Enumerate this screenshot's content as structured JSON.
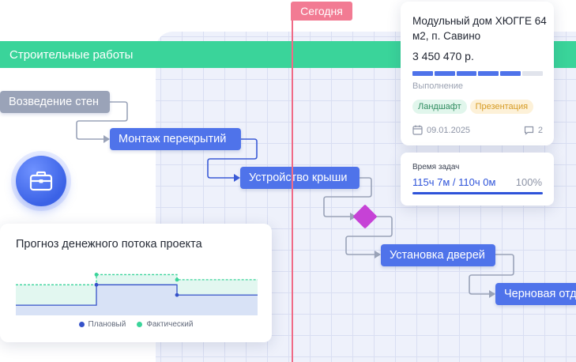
{
  "stage": {
    "label": "Строительные работы"
  },
  "today": {
    "label": "Сегодня"
  },
  "tasks": [
    {
      "label": "Возведение стен"
    },
    {
      "label": "Монтаж перекрытий"
    },
    {
      "label": "Устройство крыши"
    },
    {
      "label": "Установка дверей"
    },
    {
      "label": "Черновая отд"
    }
  ],
  "project_card": {
    "title": "Модульный дом ХЮГГЕ 64 м2, п. Савино",
    "price": "3 450 470 р.",
    "progress_caption": "Выполнение",
    "progress_segments_done": 5,
    "progress_segments_total": 6,
    "tags": [
      "Ландшафт",
      "Презентация"
    ],
    "date": "09.01.2025",
    "comments": "2"
  },
  "time_card": {
    "label": "Время задач",
    "value": "115ч 7м / 110ч 0м",
    "percent": "100%"
  },
  "cashflow": {
    "title": "Прогноз денежного потока проекта",
    "legend": {
      "planned": "Плановый",
      "actual": "Фактический"
    }
  },
  "colors": {
    "accent_blue": "#4f73ea",
    "stage_green": "#3ad49a",
    "today_red": "#f06a86",
    "milestone_purple": "#c642d6",
    "planned": "#3552c9",
    "actual": "#3ad49a"
  },
  "chart_data": {
    "type": "area",
    "title": "Прогноз денежного потока проекта",
    "series": [
      {
        "name": "Плановый",
        "values": [
          1,
          1,
          3,
          3,
          2,
          2
        ]
      },
      {
        "name": "Фактический",
        "values": [
          3,
          3,
          4,
          4,
          3.5,
          3.5
        ]
      }
    ],
    "grid": false,
    "legend": "bottom"
  }
}
